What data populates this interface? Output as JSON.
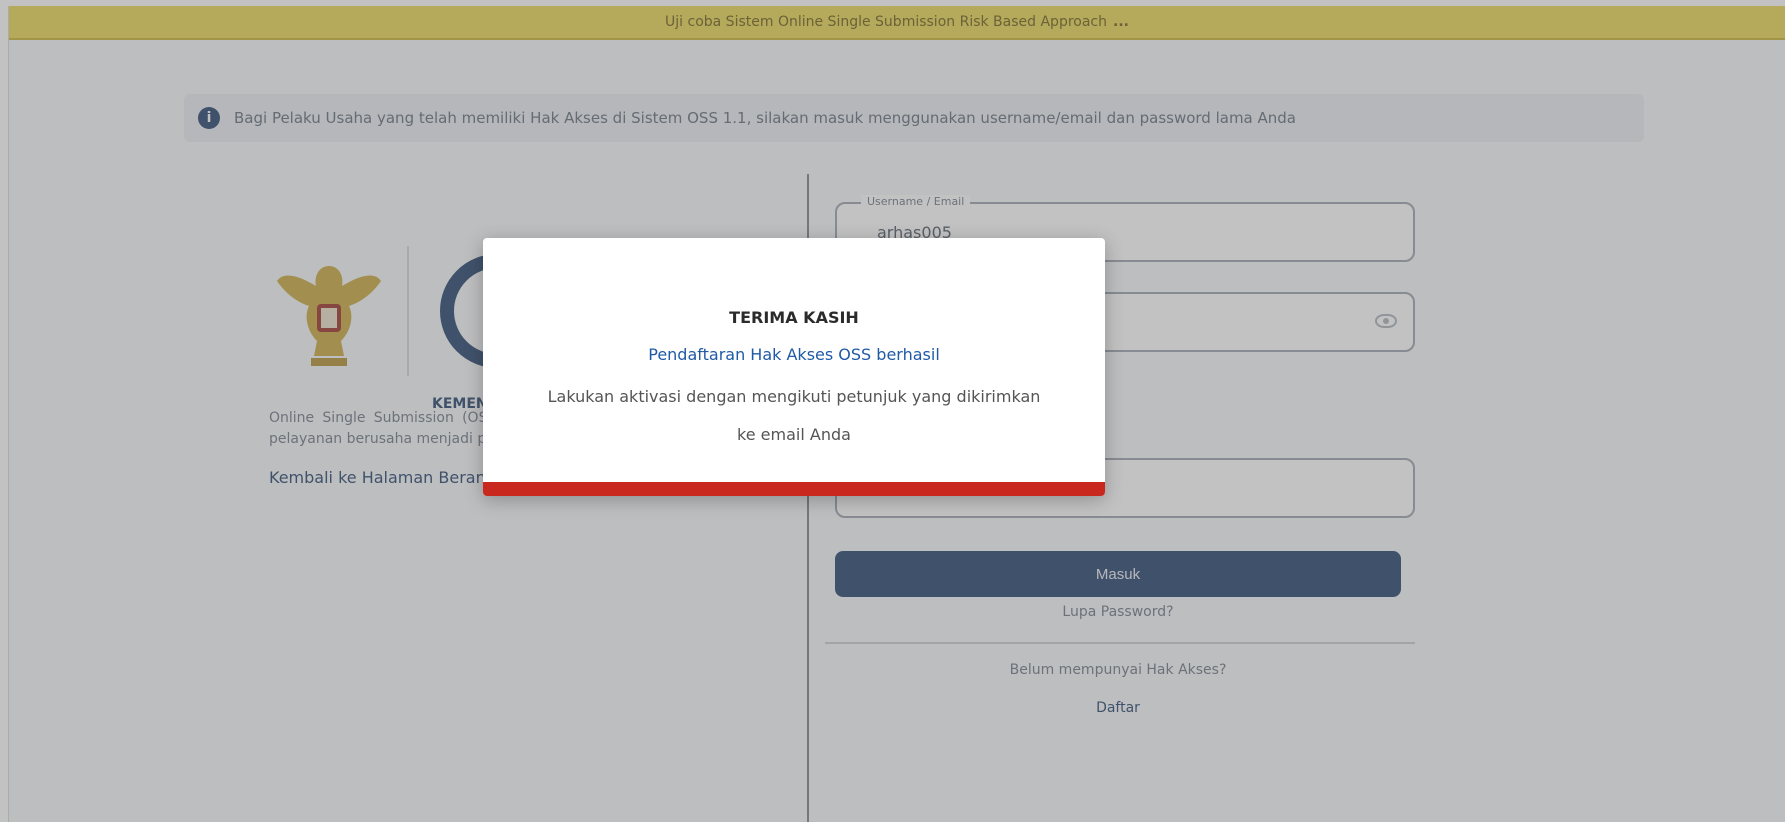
{
  "colors": {
    "banner": "#e9d44f",
    "primary": "#1f3e6a",
    "modal_bar": "#c8281e",
    "link": "#1f5aa6"
  },
  "banner": {
    "text": "Uji coba Sistem Online Single Submission Risk Based Approach",
    "bold": "..."
  },
  "info": {
    "icon": "info-icon",
    "text": "Bagi Pelaku Usaha yang telah memiliki Hak Akses di Sistem OSS 1.1, silakan masuk menggunakan username/email dan password lama Anda"
  },
  "left": {
    "logo_text": "KEMENTERIAN",
    "description": "Online Single Submission (OSS) ... kemudahan ... sistem OSS ... pelayanan berusaha menjadi pasti, mudah, efektif dan transparan.",
    "back_link": "Kembali ke Halaman Beranda OSS"
  },
  "login": {
    "field1_label": "Username / Email",
    "field1_value": "arhas005",
    "field2_value": "",
    "field3_value": "",
    "submit": "Masuk",
    "forgot": "Lupa Password?",
    "no_access": "Belum mempunyai Hak Akses?",
    "register": "Daftar"
  },
  "modal": {
    "title": "TERIMA KASIH",
    "subtitle": "Pendaftaran Hak Akses OSS berhasil",
    "body": "Lakukan aktivasi dengan mengikuti petunjuk yang dikirimkan ke email Anda"
  }
}
